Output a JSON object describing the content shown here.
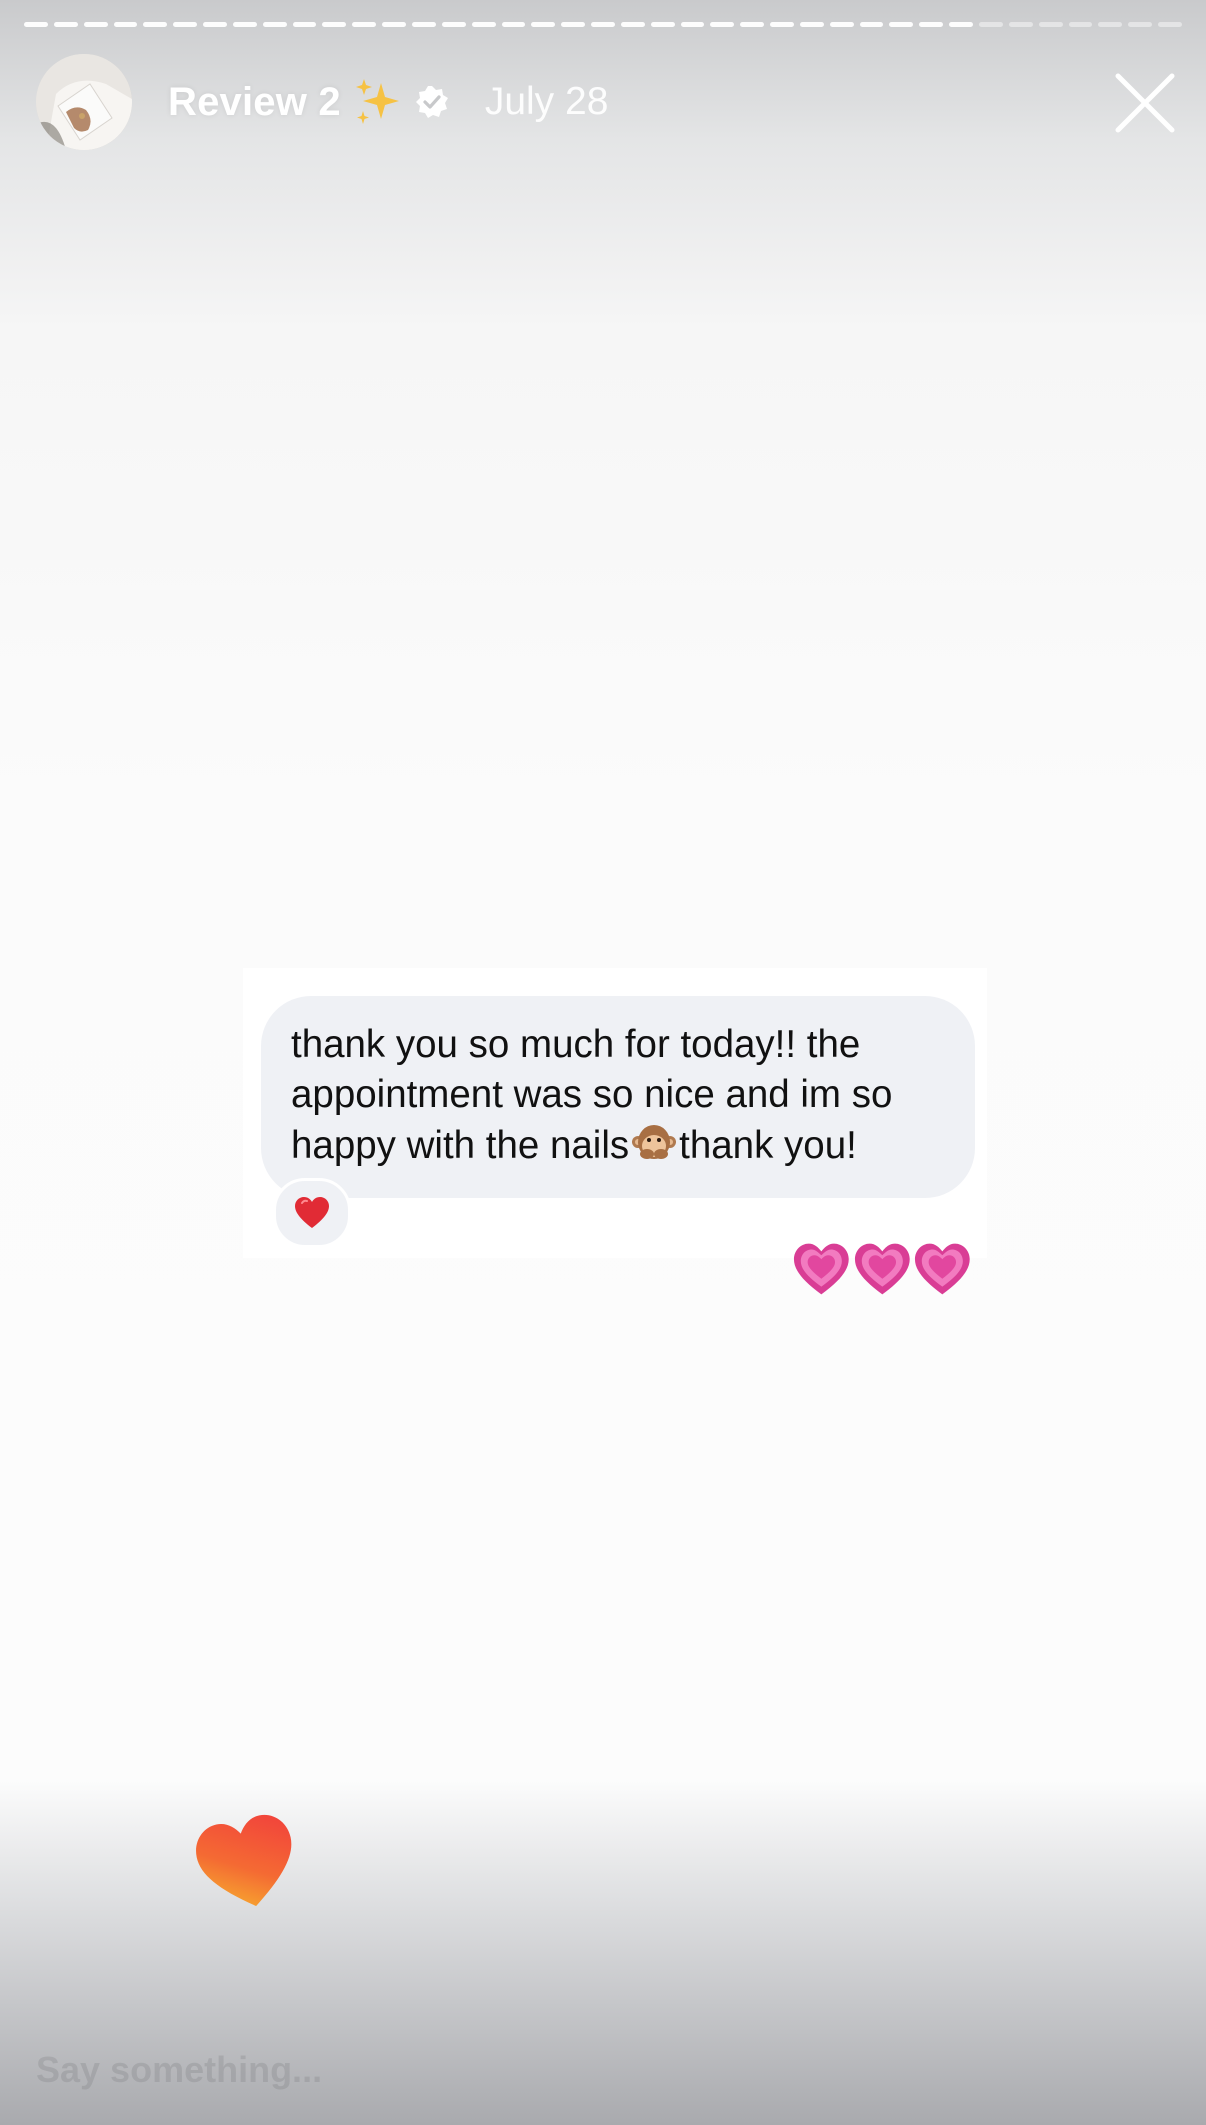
{
  "story": {
    "progress_segments_total": 39,
    "progress_segments_viewed": 32,
    "title": "Review 2",
    "title_emoji": "sparkles-icon",
    "verified_badge": "verified-badge-icon",
    "date": "July 28",
    "close_icon": "close-icon"
  },
  "message": {
    "lines": [
      "thank you so much for today!! the",
      "appointment was so nice and im so"
    ],
    "line3_before_emoji": "happy with the nails",
    "line3_emoji": "speak-no-evil-monkey-icon",
    "line3_after_emoji": "thank you!",
    "reaction_emoji": "red-heart-icon",
    "reply_emojis": [
      "growing-heart-icon",
      "growing-heart-icon",
      "growing-heart-icon"
    ]
  },
  "footer": {
    "like_icon": "heart-like-icon",
    "reply_placeholder": "Say something..."
  },
  "colors": {
    "bubble_background": "#eff1f5",
    "text": "#111111",
    "pink_heart": "#e94ba6",
    "like_heart_top": "#f2453b",
    "like_heart_bottom": "#f7b12e"
  }
}
